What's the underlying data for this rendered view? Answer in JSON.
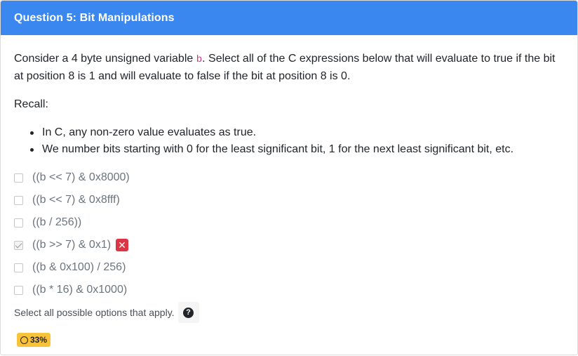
{
  "header": {
    "title": "Question 5: Bit Manipulations"
  },
  "prompt": {
    "part1": "Consider a 4 byte unsigned variable ",
    "variable": "b",
    "part2": ". Select all of the C expressions below that will evaluate to true if the bit at position 8 is 1 and will evaluate to false if the bit at position 8 is 0."
  },
  "recall": {
    "label": "Recall:",
    "items": [
      "In C, any non-zero value evaluates as true.",
      "We number bits starting with 0 for the least significant bit, 1 for the next least significant bit, etc."
    ]
  },
  "options": [
    {
      "label": "((b << 7) & 0x8000)",
      "checked": false
    },
    {
      "label": "((b << 7) & 0x8fff)",
      "checked": false
    },
    {
      "label": "((b / 256))",
      "checked": false
    },
    {
      "label": "((b >> 7) & 0x1)",
      "checked": true,
      "marked_wrong": true
    },
    {
      "label": "((b & 0x100) / 256)",
      "checked": false
    },
    {
      "label": "((b * 16) & 0x1000)",
      "checked": false
    }
  ],
  "wrong_mark": "✕",
  "help": {
    "text": "Select all possible options that apply.",
    "icon": "question-circle-icon",
    "icon_glyph": "?"
  },
  "score": {
    "value": "33%"
  },
  "colors": {
    "header": "#3a87f0",
    "wrong": "#dc3545",
    "score": "#f8c33a",
    "variable": "#d63384"
  }
}
